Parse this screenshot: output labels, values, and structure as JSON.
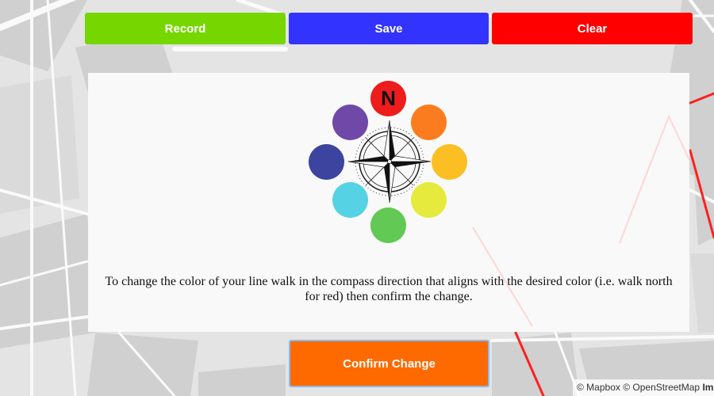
{
  "toolbar": {
    "record_label": "Record",
    "save_label": "Save",
    "clear_label": "Clear"
  },
  "compass": {
    "north_label": "N",
    "colors": {
      "north": "#ee1c1c",
      "northeast": "#fb7c1e",
      "east": "#fbbf24",
      "southeast": "#e6ea3c",
      "south": "#62c954",
      "southwest": "#55d2e4",
      "west": "#3d44a0",
      "northwest": "#6f48a8"
    }
  },
  "instructions": "To change the color of your line walk in the compass direction that aligns with the desired color (i.e. walk north for red) then confirm the change.",
  "confirm_label": "Confirm Change",
  "attribution": {
    "mapbox": "© Mapbox",
    "osm": "© OpenStreetMap",
    "more": "Im"
  },
  "colors": {
    "record": "#76d600",
    "save": "#3333ff",
    "clear": "#ff0000",
    "confirm": "#ff6a00",
    "route": "#ff0000"
  }
}
